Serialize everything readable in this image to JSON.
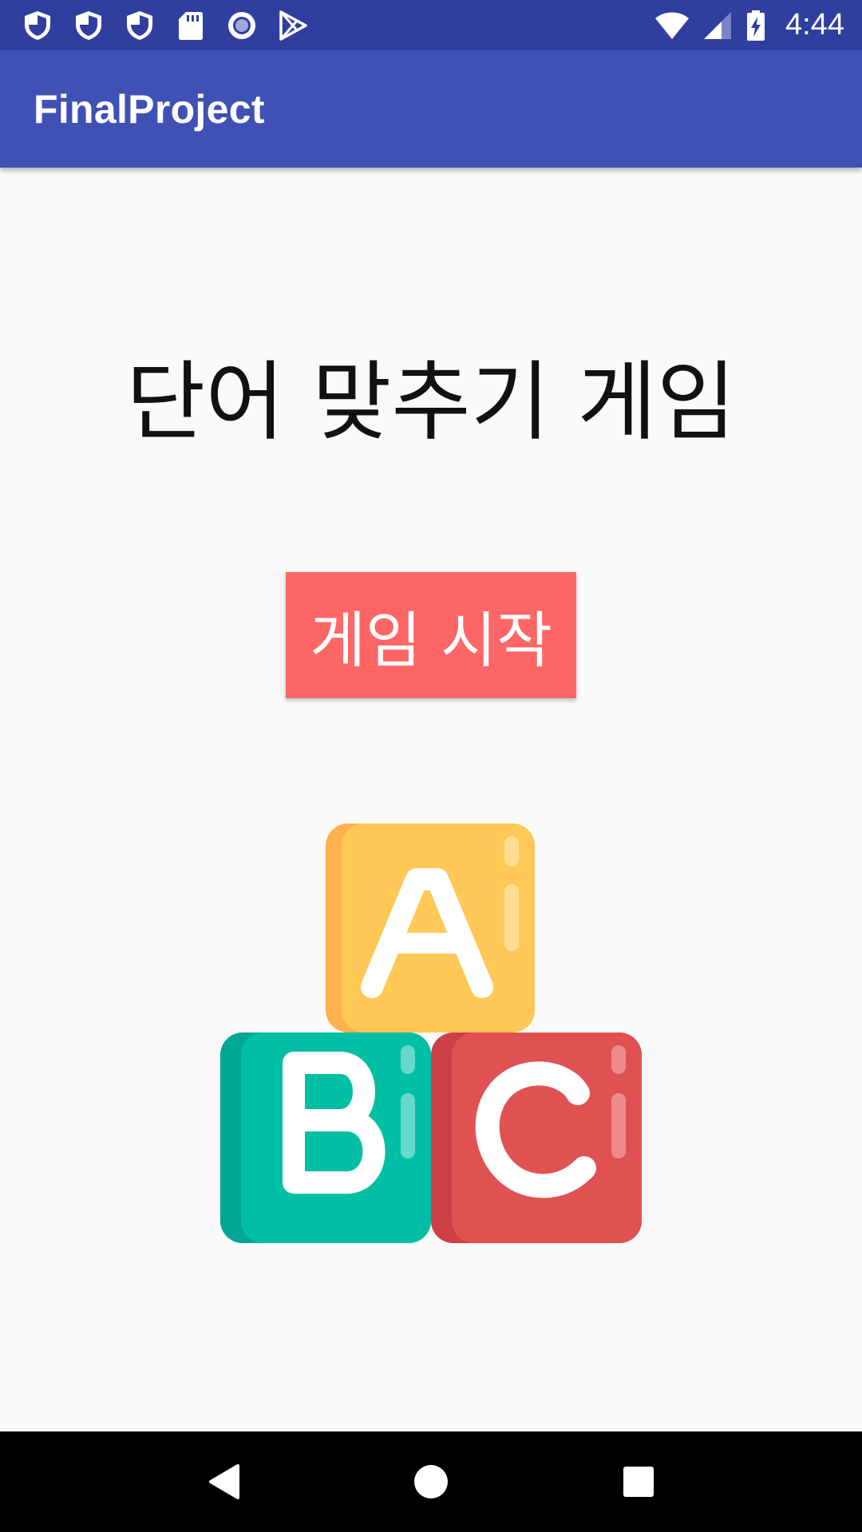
{
  "status_bar": {
    "time": "4:44",
    "left_icons": [
      "shield-icon",
      "shield-icon",
      "shield-icon",
      "sd-card-icon",
      "record-icon",
      "play-store-icon"
    ],
    "right_icons": [
      "wifi-icon",
      "cell-signal-icon",
      "battery-charging-icon"
    ],
    "background": "#303f9f"
  },
  "app_bar": {
    "title": "FinalProject",
    "background": "#3f51b5"
  },
  "main": {
    "title": "단어 맞추기 게임",
    "start_button_label": "게임 시작",
    "start_button_color": "#ff6666",
    "illustration": {
      "name": "abc-blocks-icon",
      "blocks": [
        "A",
        "B",
        "C"
      ],
      "colors": [
        "#ffc857",
        "#00bfa5",
        "#e05252"
      ]
    }
  },
  "nav_bar": {
    "buttons": [
      "back-icon",
      "home-icon",
      "recents-icon"
    ]
  }
}
